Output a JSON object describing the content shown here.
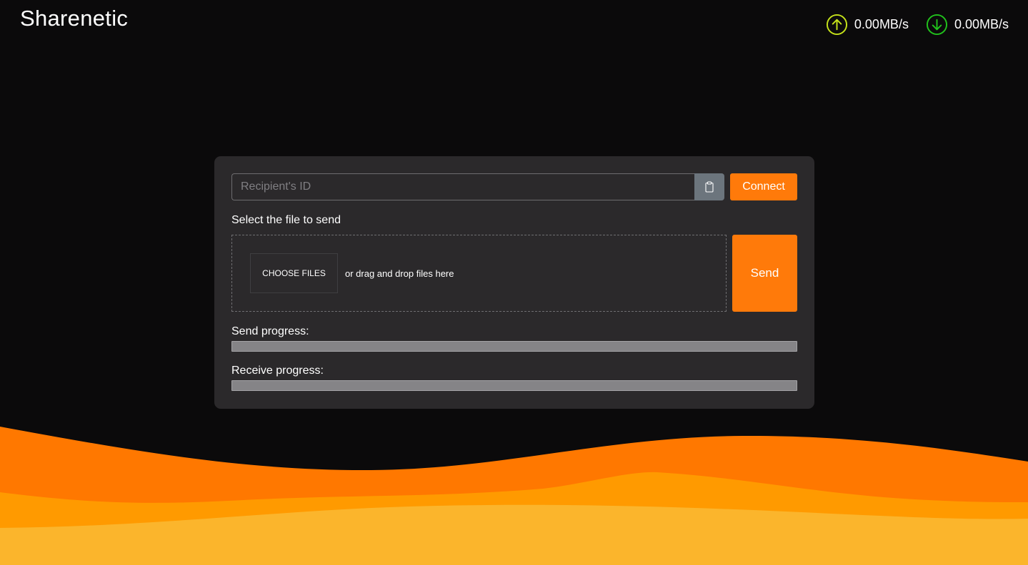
{
  "header": {
    "app_title": "Sharenetic",
    "upload_speed": "0.00MB/s",
    "download_speed": "0.00MB/s",
    "upload_icon": "arrow-up-circle-icon",
    "download_icon": "arrow-down-circle-icon",
    "upload_color": "#c6e31a",
    "download_color": "#21c31c"
  },
  "connect": {
    "recipient_placeholder": "Recipient's ID",
    "recipient_value": "",
    "paste_icon": "clipboard-icon",
    "connect_label": "Connect"
  },
  "file": {
    "section_label": "Select the file to send",
    "choose_label": "CHOOSE FILES",
    "drop_hint": "or drag and drop files here",
    "send_label": "Send"
  },
  "progress": {
    "send_label": "Send progress:",
    "send_value": 0,
    "receive_label": "Receive progress:",
    "receive_value": 0
  },
  "colors": {
    "accent": "#ff7a0a",
    "background": "#0b0a0b",
    "card": "#2b292b",
    "wave_back": "#ff7800",
    "wave_mid": "#ff9a00",
    "wave_front": "#fbb52c"
  }
}
